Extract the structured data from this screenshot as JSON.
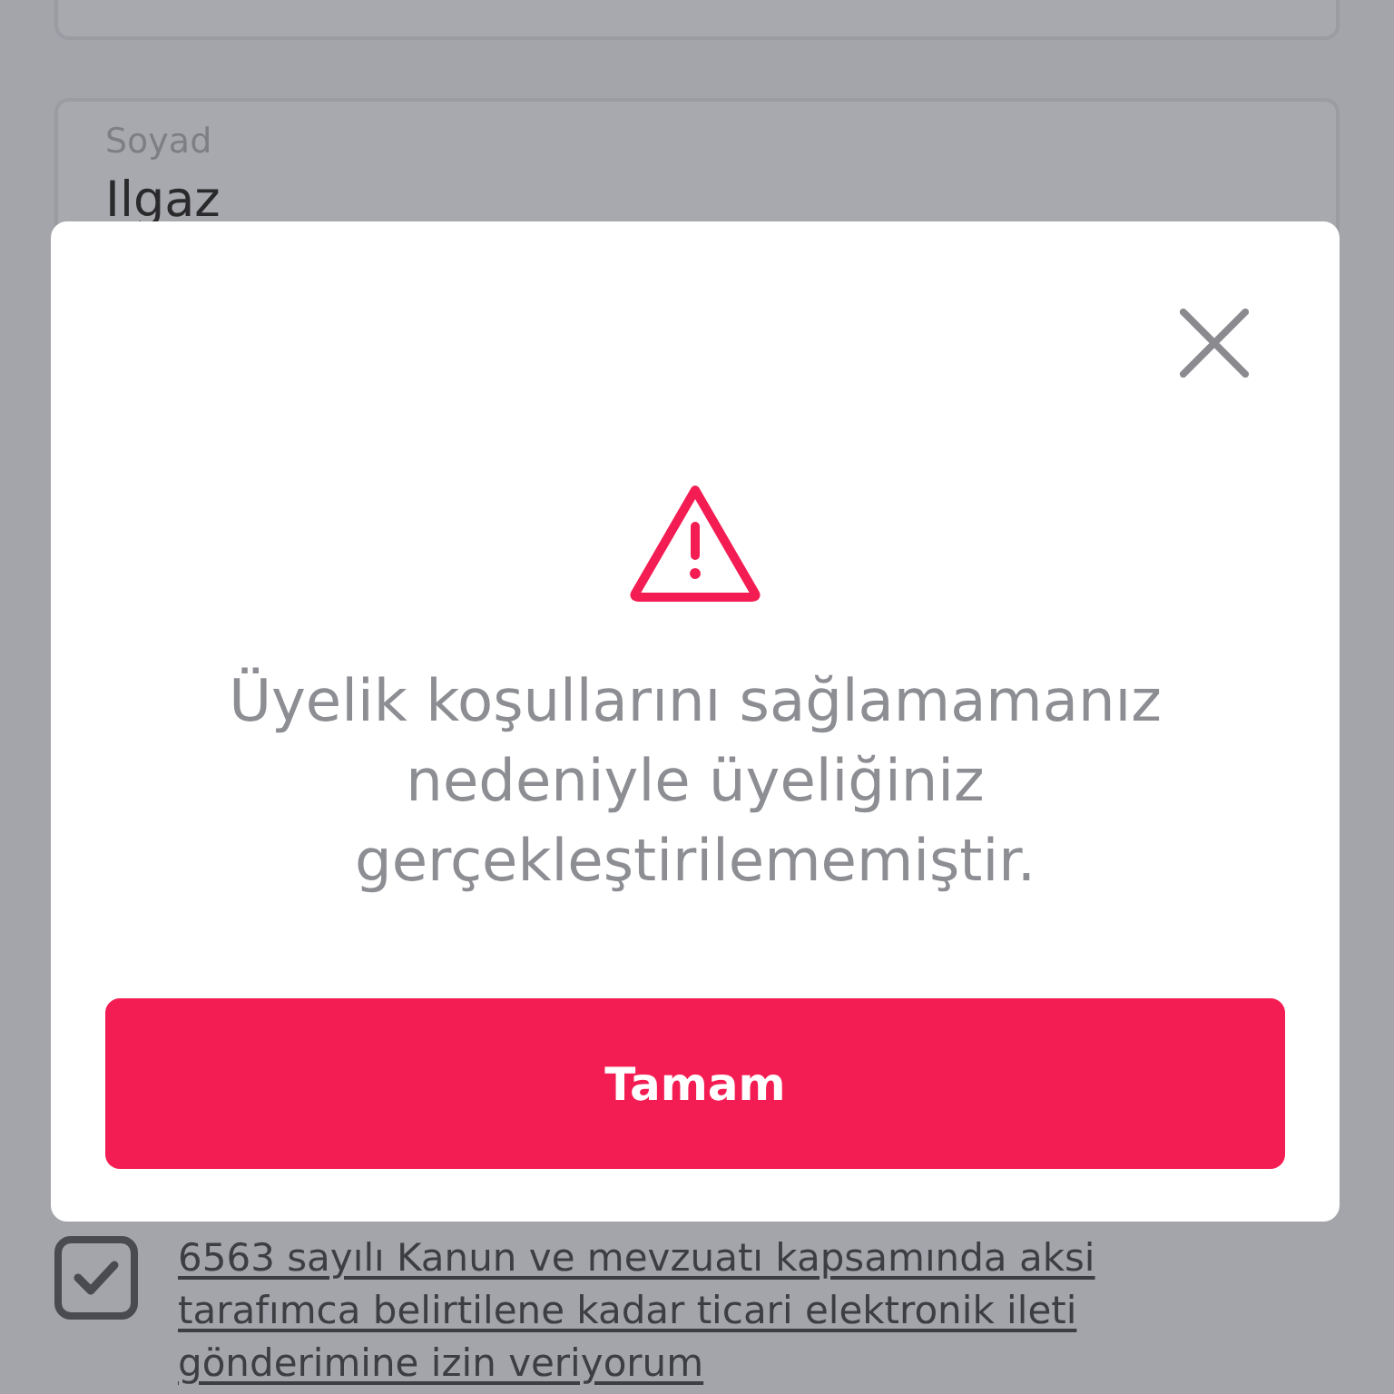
{
  "form": {
    "fields": [
      {
        "label": "Soyad",
        "value": "Ilgaz"
      }
    ],
    "consent": {
      "checked": true,
      "text": "6563 sayılı Kanun ve mevzuatı kapsamında aksi tarafımca belirtilene kadar ticari elektronik ileti gönderimine izin veriyorum"
    }
  },
  "dialog": {
    "message": "Üyelik koşullarını sağlamamanız nedeniyle üyeliğiniz gerçekleştirilememiştir.",
    "button": "Tamam"
  }
}
